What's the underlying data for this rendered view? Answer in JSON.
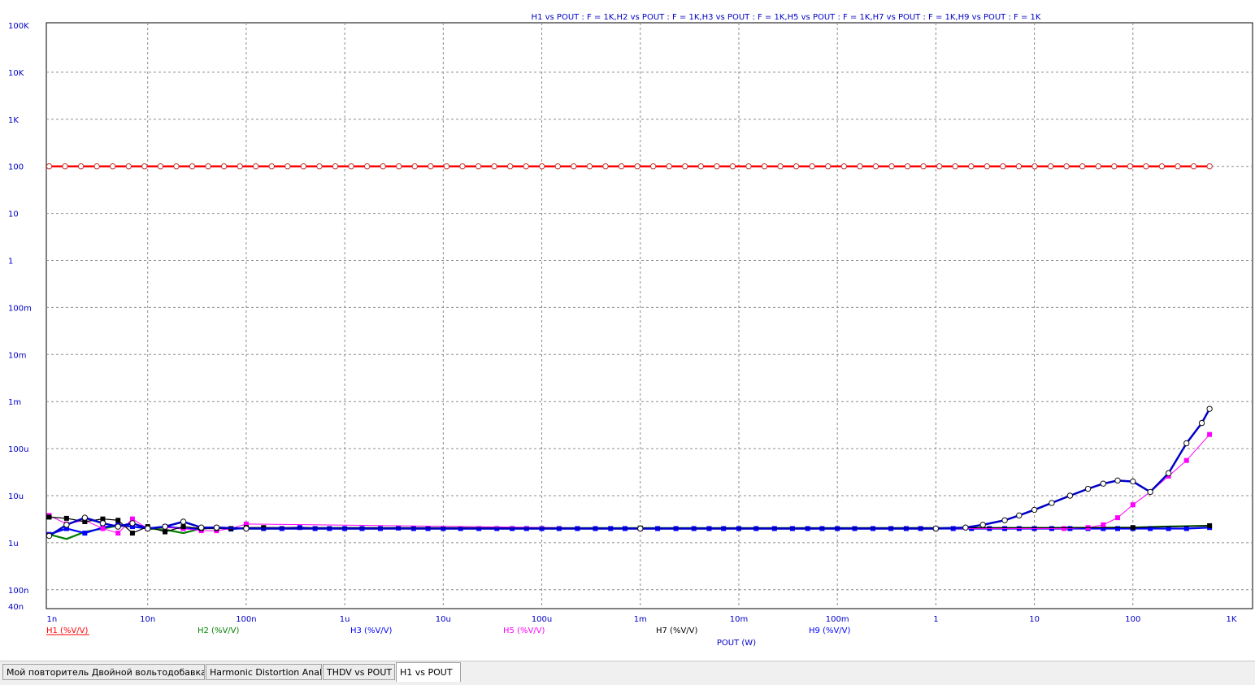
{
  "chart_data": {
    "type": "line",
    "title": "H1 vs POUT : F = 1K,H2 vs POUT : F = 1K,H3 vs POUT : F = 1K,H5 vs POUT : F = 1K,H7 vs POUT : F = 1K,H9 vs POUT : F = 1K",
    "xlabel": "POUT (W)",
    "ylabel": "",
    "x_scale": "log",
    "y_scale": "log",
    "xlim": [
      1e-09,
      1000
    ],
    "ylim": [
      4e-08,
      100000
    ],
    "grid": true,
    "x_ticks": [
      {
        "value": 1e-09,
        "label": "1n"
      },
      {
        "value": 1e-08,
        "label": "10n"
      },
      {
        "value": 1e-07,
        "label": "100n"
      },
      {
        "value": 1e-06,
        "label": "1u"
      },
      {
        "value": 1e-05,
        "label": "10u"
      },
      {
        "value": 0.0001,
        "label": "100u"
      },
      {
        "value": 0.001,
        "label": "1m"
      },
      {
        "value": 0.01,
        "label": "10m"
      },
      {
        "value": 0.1,
        "label": "100m"
      },
      {
        "value": 1,
        "label": "1"
      },
      {
        "value": 10,
        "label": "10"
      },
      {
        "value": 100,
        "label": "100"
      },
      {
        "value": 1000,
        "label": "1K"
      }
    ],
    "y_ticks": [
      {
        "value": 100000,
        "label": "100K"
      },
      {
        "value": 10000,
        "label": "10K"
      },
      {
        "value": 1000,
        "label": "1K"
      },
      {
        "value": 100,
        "label": "100"
      },
      {
        "value": 10,
        "label": "10"
      },
      {
        "value": 1,
        "label": "1"
      },
      {
        "value": 0.1,
        "label": "100m"
      },
      {
        "value": 0.01,
        "label": "10m"
      },
      {
        "value": 0.001,
        "label": "1m"
      },
      {
        "value": 0.0001,
        "label": "100u"
      },
      {
        "value": 1e-05,
        "label": "10u"
      },
      {
        "value": 1e-06,
        "label": "1u"
      },
      {
        "value": 1e-07,
        "label": "100n"
      },
      {
        "value": 4e-08,
        "label": "40n"
      }
    ],
    "series": [
      {
        "name": "H1 (%V/V)",
        "color": "#ff0000",
        "marker": "circle-open",
        "width": 2.5,
        "x": [
          1e-09,
          0.001,
          600
        ],
        "values": [
          100,
          100,
          100
        ]
      },
      {
        "name": "H2 (%V/V)",
        "color": "#008000",
        "marker": "none",
        "width": 2.2,
        "x": [
          1e-09,
          1.5e-09,
          2.3e-09,
          3.5e-09,
          5e-09,
          7e-09,
          1e-08,
          1.5e-08,
          2.3e-08,
          3.5e-08,
          5e-08,
          1e-07,
          1e-06,
          0.001,
          10,
          100,
          200,
          600
        ],
        "values": [
          1.5e-06,
          1.2e-06,
          1.7e-06,
          2e-06,
          2.3e-06,
          2.2e-06,
          2e-06,
          1.9e-06,
          1.6e-06,
          2e-06,
          2.1e-06,
          2e-06,
          2.05e-06,
          2.05e-06,
          2.05e-06,
          2.1e-06,
          2.2e-06,
          2.3e-06
        ]
      },
      {
        "name": "H3 (%V/V)",
        "color": "#0000ff",
        "marker": "square",
        "width": 2.2,
        "x": [
          1e-09,
          1.5e-09,
          2.3e-09,
          3.5e-09,
          5e-09,
          7e-09,
          1e-08,
          1.5e-08,
          2.3e-08,
          3.5e-08,
          5e-08,
          7e-08,
          1e-07,
          1.5e-07,
          2.3e-07,
          3.5e-07,
          5e-07,
          7e-07,
          1e-06,
          1.5e-06,
          2.3e-06,
          3.5e-06,
          5e-06,
          7e-06,
          1e-05,
          1.5e-05,
          2.3e-05,
          3.5e-05,
          5e-05,
          7e-05,
          0.0001,
          0.00015,
          0.00023,
          0.00035,
          0.0005,
          0.0007,
          0.001,
          0.0015,
          0.0023,
          0.0035,
          0.005,
          0.007,
          0.01,
          0.015,
          0.023,
          0.035,
          0.05,
          0.07,
          0.1,
          0.15,
          0.23,
          0.35,
          0.5,
          0.7,
          1,
          1.5,
          2.3,
          3.5,
          5,
          7,
          10,
          15,
          23,
          35,
          50,
          70,
          100,
          150,
          230,
          350,
          600
        ],
        "values": [
          1.5e-06,
          2e-06,
          1.6e-06,
          2.1e-06,
          2.4e-06,
          2.2e-06,
          2e-06,
          2.2e-06,
          2e-06,
          2e-06,
          2.1e-06,
          1.95e-06,
          2.05e-06,
          2e-06,
          2e-06,
          2.1e-06,
          2e-06,
          2e-06,
          2e-06,
          2e-06,
          2e-06,
          2.05e-06,
          2e-06,
          2e-06,
          2e-06,
          2e-06,
          2e-06,
          2e-06,
          2e-06,
          2e-06,
          2e-06,
          2e-06,
          2e-06,
          2e-06,
          2e-06,
          2e-06,
          2e-06,
          2e-06,
          2e-06,
          2e-06,
          2e-06,
          2e-06,
          2e-06,
          2e-06,
          2e-06,
          2e-06,
          2e-06,
          2e-06,
          2e-06,
          2e-06,
          2e-06,
          2e-06,
          2e-06,
          2e-06,
          2e-06,
          2e-06,
          2e-06,
          2e-06,
          2e-06,
          2e-06,
          2e-06,
          2e-06,
          2e-06,
          2e-06,
          2e-06,
          2e-06,
          2e-06,
          2e-06,
          2e-06,
          2e-06,
          2.1e-06
        ]
      },
      {
        "name": "H5 (%V/V)",
        "color": "#ff00ff",
        "marker": "square",
        "width": 1,
        "x": [
          1e-09,
          1.5e-09,
          2.3e-09,
          3.5e-09,
          5e-09,
          7e-09,
          1e-08,
          1.5e-08,
          2.3e-08,
          3.5e-08,
          5e-08,
          7e-08,
          1e-07,
          0.001,
          20,
          35,
          50,
          70,
          100,
          150,
          230,
          350,
          600
        ],
        "values": [
          3.8e-06,
          2.5e-06,
          3e-06,
          2e-06,
          1.6e-06,
          3.2e-06,
          2e-06,
          2.1e-06,
          2e-06,
          1.8e-06,
          1.8e-06,
          2e-06,
          2.5e-06,
          2e-06,
          2e-06,
          2.1e-06,
          2.4e-06,
          3.4e-06,
          6.4e-06,
          1.2e-05,
          2.6e-05,
          5.6e-05,
          0.0002
        ]
      },
      {
        "name": "H7 (%V/V)",
        "color": "#000000",
        "marker": "square",
        "width": 1.2,
        "x": [
          1e-09,
          1.5e-09,
          2.3e-09,
          3.5e-09,
          5e-09,
          7e-09,
          1e-08,
          1.5e-08,
          2.3e-08,
          3.5e-08,
          5e-08,
          7e-08,
          1e-07,
          1.5e-07,
          0.001,
          100,
          600
        ],
        "values": [
          3.5e-06,
          3.3e-06,
          2.8e-06,
          3.2e-06,
          3e-06,
          1.6e-06,
          2.2e-06,
          1.7e-06,
          2.2e-06,
          2e-06,
          2e-06,
          2e-06,
          2.1e-06,
          2.1e-06,
          2.05e-06,
          2.1e-06,
          2.3e-06
        ]
      },
      {
        "name": "H9 (%V/V)",
        "color": "#0000c8",
        "marker": "circle-open",
        "width": 2.5,
        "x": [
          1e-09,
          1.5e-09,
          2.3e-09,
          3.5e-09,
          5e-09,
          7e-09,
          1e-08,
          1.5e-08,
          2.3e-08,
          3.5e-08,
          5e-08,
          1e-07,
          0.001,
          1,
          2,
          3,
          5,
          7,
          10,
          15,
          23,
          35,
          50,
          70,
          100,
          150,
          230,
          350,
          500,
          600
        ],
        "values": [
          1.4e-06,
          2.4e-06,
          3.4e-06,
          2.6e-06,
          2.2e-06,
          2.6e-06,
          2e-06,
          2.2e-06,
          2.8e-06,
          2.1e-06,
          2.1e-06,
          2e-06,
          2e-06,
          2e-06,
          2.1e-06,
          2.4e-06,
          3e-06,
          3.8e-06,
          5e-06,
          7e-06,
          1e-05,
          1.4e-05,
          1.8e-05,
          2.1e-05,
          2e-05,
          1.2e-05,
          3e-05,
          0.00013,
          0.00035,
          0.0007
        ]
      }
    ]
  },
  "tabs": [
    {
      "label": "Мой повторитель Двойной вольтодобавка.CIR"
    },
    {
      "label": "Harmonic Distortion Analysis"
    },
    {
      "label": "THDV vs POUT"
    },
    {
      "label": "H1 vs POUT"
    }
  ]
}
